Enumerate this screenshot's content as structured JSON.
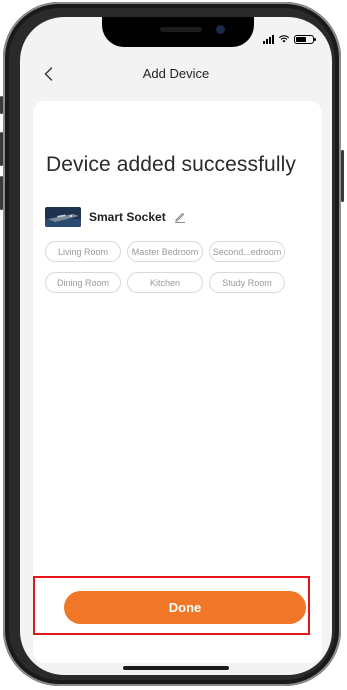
{
  "nav": {
    "title": "Add Device",
    "back_icon": "chevron-left-icon"
  },
  "main": {
    "headline": "Device added successfully",
    "device": {
      "name": "Smart Socket",
      "edit_icon": "pencil-icon"
    },
    "rooms": [
      {
        "label": "Living Room"
      },
      {
        "label": "Master Bedroom"
      },
      {
        "label": "Second...edroom"
      },
      {
        "label": "Dining Room"
      },
      {
        "label": "Kitchen"
      },
      {
        "label": "Study Room"
      }
    ]
  },
  "footer": {
    "done_label": "Done"
  },
  "colors": {
    "accent": "#f07628",
    "highlight_border": "#e3141a"
  }
}
